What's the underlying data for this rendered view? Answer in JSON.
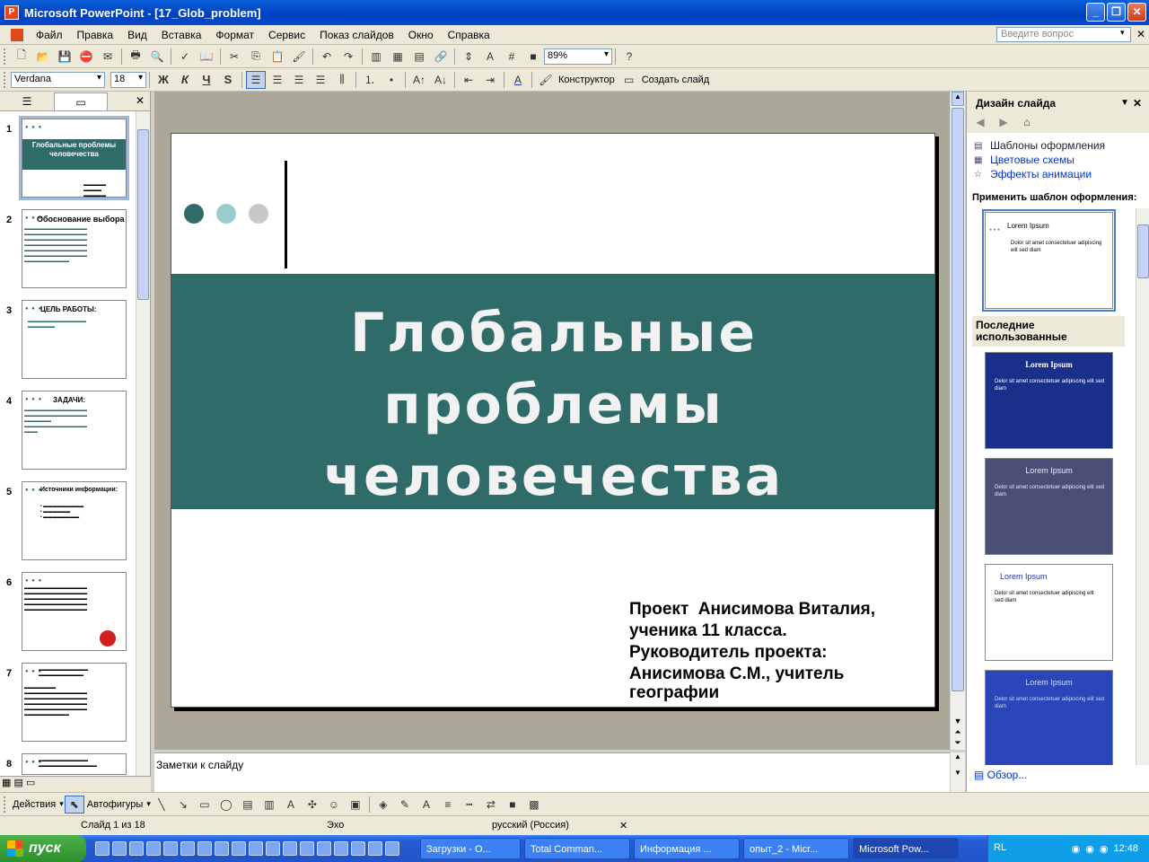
{
  "window": {
    "title": "Microsoft PowerPoint - [17_Glob_problem]",
    "buttons": [
      "_",
      "❐",
      "✕"
    ]
  },
  "menu": {
    "items": [
      "Файл",
      "Правка",
      "Вид",
      "Вставка",
      "Формат",
      "Сервис",
      "Показ слайдов",
      "Окно",
      "Справка"
    ],
    "ask_placeholder": "Введите вопрос"
  },
  "toolbar_standard": {
    "zoom": "89%"
  },
  "toolbar_formatting": {
    "font": "Verdana",
    "size": "18",
    "bold": "Ж",
    "italic": "К",
    "underline": "Ч",
    "shadow": "S",
    "designer": "Конструктор",
    "new_slide": "Создать слайд"
  },
  "thumbnails": [
    {
      "num": "1",
      "title": "Глобальные проблемы человечества"
    },
    {
      "num": "2",
      "title": "Обоснование выбора"
    },
    {
      "num": "3",
      "title": "ЦЕЛЬ РАБОТЫ:"
    },
    {
      "num": "4",
      "title": "ЗАДАЧИ:"
    },
    {
      "num": "5",
      "title": "Источники информации:"
    },
    {
      "num": "6",
      "title": ""
    },
    {
      "num": "7",
      "title": ""
    },
    {
      "num": "8",
      "title": ""
    }
  ],
  "slide": {
    "title_lines": [
      "Глобальные",
      "проблемы",
      "человечества"
    ],
    "author_lines": [
      "Проект  Анисимова Виталия,",
      "ученика 11 класса.",
      "Руководитель проекта:",
      "Анисимова С.М., учитель",
      "географии"
    ],
    "dot_colors": [
      "#2f6b68",
      "#9bcbcb",
      "#c8c8c8"
    ],
    "band_color": "#2f6b68"
  },
  "notes": {
    "placeholder": "Заметки к слайду"
  },
  "taskpane": {
    "title": "Дизайн слайда",
    "links": [
      "Шаблоны оформления",
      "Цветовые схемы",
      "Эффекты анимации"
    ],
    "apply_label": "Применить шаблон оформления:",
    "recent_label": "Последние использованные",
    "templates": [
      {
        "title": "Lorem Ipsum",
        "bullet": "Dolor sit amet consectetuer adipiscing elit sed diam",
        "bg": "#ffffff",
        "fg": "#000000"
      },
      {
        "title": "Lorem Ipsum",
        "bullet": "Delor sit amet consectetuer adipiscing elit sed diam",
        "bg": "#1a2f8a",
        "fg": "#ffffff"
      },
      {
        "title": "Lorem Ipsum",
        "bullet": "Delor sit amet consectetuer adipiscing elit sed diam",
        "bg": "#4a4f78",
        "fg": "#e8e8ff"
      },
      {
        "title": "Lorem Ipsum",
        "bullet": "Delor sit amet consectetuer adipiscing elit sed diam",
        "bg": "#ffffff",
        "fg": "#223399"
      },
      {
        "title": "Lorem Ipsum",
        "bullet": "Delor sit amet consectetuer adipiscing elit sed diam",
        "bg": "#2a46b8",
        "fg": "#d0dcff"
      }
    ],
    "browse": "Обзор..."
  },
  "drawing": {
    "actions": "Действия",
    "autoshapes": "Автофигуры"
  },
  "status": {
    "slide_info": "Слайд 1 из 18",
    "design": "Эхо",
    "language": "русский (Россия)"
  },
  "taskbar": {
    "start": "пуск",
    "tasks": [
      "Загрузки - О...",
      "Total Comman...",
      "Информация ...",
      "опыт_2 - Micr...",
      "Microsoft Pow..."
    ],
    "lang": "RL",
    "clock": "12:48"
  }
}
